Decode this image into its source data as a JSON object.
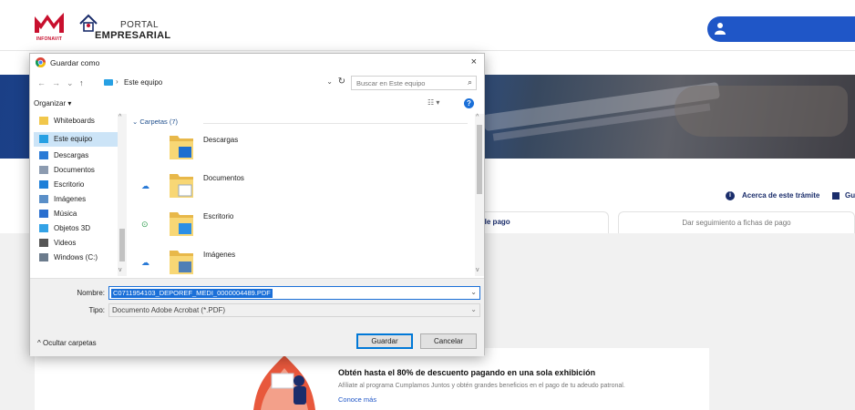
{
  "portal": {
    "brand_small": "INFONAVIT",
    "logo_line1": "PORTAL",
    "logo_line2": "EMPRESARIAL",
    "about_link": "Acerca de este trámite",
    "guide_link": "Gu",
    "tab_active_partial": "de pago",
    "tab_follow": "Dar seguimiento a fichas de pago",
    "promo_title": "Obtén hasta el 80% de descuento pagando en una sola exhibición",
    "promo_text": "Afíliate al programa Cumplamos Juntos y obtén grandes beneficios en el pago de tu adeudo patronal.",
    "promo_link": "Conoce más"
  },
  "dialog": {
    "title": "Guardar como",
    "close_icon": "×",
    "nav": {
      "back": "←",
      "forward": "→",
      "recent": "⌄",
      "up": "↑"
    },
    "address": {
      "separator": "›",
      "location": "Este equipo",
      "dropdown": "⌄",
      "refresh": "↻"
    },
    "search": {
      "placeholder": "Buscar en Este equipo",
      "icon": "⌕"
    },
    "toolbar": {
      "organize": "Organizar ▾",
      "view": "☷ ▾",
      "help": "?"
    },
    "nav_pane": [
      {
        "label": "Whiteboards",
        "icon": "folder-icon",
        "color": "#f1c74b"
      },
      {
        "label": "Este equipo",
        "icon": "computer-icon",
        "color": "#27a0e3",
        "selected": true
      },
      {
        "label": "Descargas",
        "icon": "download-icon",
        "color": "#2a7ad6"
      },
      {
        "label": "Documentos",
        "icon": "document-icon",
        "color": "#8c9bb0"
      },
      {
        "label": "Escritorio",
        "icon": "desktop-icon",
        "color": "#1e7fd8"
      },
      {
        "label": "Imágenes",
        "icon": "image-icon",
        "color": "#5a8fc8"
      },
      {
        "label": "Música",
        "icon": "music-icon",
        "color": "#2a6fcf"
      },
      {
        "label": "Objetos 3D",
        "icon": "cube-icon",
        "color": "#33a2e6"
      },
      {
        "label": "Videos",
        "icon": "video-icon",
        "color": "#555555"
      },
      {
        "label": "Windows (C:)",
        "icon": "drive-icon",
        "color": "#6b7b8c"
      }
    ],
    "group_header": "Carpetas (7)",
    "files": [
      {
        "name": "Descargas",
        "status": "",
        "overlay": "download"
      },
      {
        "name": "Documentos",
        "status": "☁",
        "status_type": "cloud",
        "overlay": "document"
      },
      {
        "name": "Escritorio",
        "status": "⊙",
        "status_type": "ok",
        "overlay": "desktop"
      },
      {
        "name": "Imágenes",
        "status": "☁",
        "status_type": "cloud",
        "overlay": "image"
      }
    ],
    "name_label": "Nombre:",
    "name_value": "C0711954103_DEPOREF_MEDI_0000004489.PDF",
    "type_label": "Tipo:",
    "type_value": "Documento Adobe Acrobat (*.PDF)",
    "hide_folders": "^ Ocultar carpetas",
    "save_button": "Guardar",
    "cancel_button": "Cancelar"
  },
  "colors": {
    "accent": "#1a6fd8",
    "portal_blue": "#1f56c7",
    "navy": "#1a2d6b",
    "selection": "#cce4f7"
  }
}
